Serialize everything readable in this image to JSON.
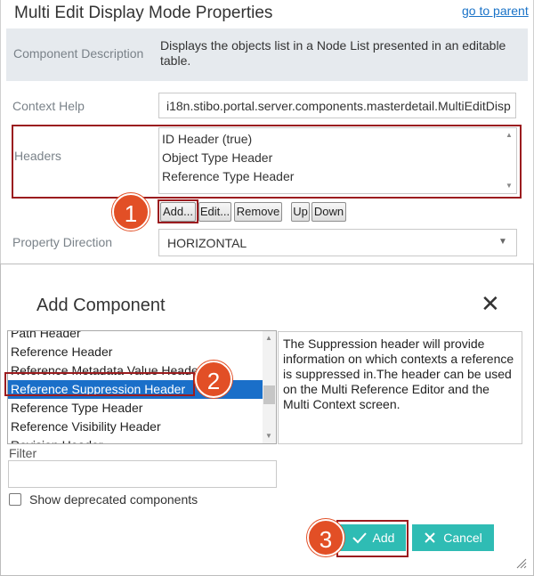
{
  "properties": {
    "title": "Multi Edit Display Mode Properties",
    "parent_link": "go to parent",
    "component_description": {
      "label": "Component Description",
      "text": "Displays the objects list in a Node List presented in an editable table."
    },
    "context_help": {
      "label": "Context Help",
      "value": "i18n.stibo.portal.server.components.masterdetail.MultiEditDisp"
    },
    "headers": {
      "label": "Headers",
      "items": [
        "ID Header (true)",
        "Object Type Header",
        "Reference Type Header"
      ]
    },
    "buttons": {
      "add": "Add...",
      "edit": "Edit...",
      "remove": "Remove",
      "up": "Up",
      "down": "Down"
    },
    "property_direction": {
      "label": "Property Direction",
      "value": "HORIZONTAL"
    }
  },
  "dialog": {
    "title": "Add Component",
    "components": [
      "Path Header",
      "Reference Header",
      "Reference Metadata Value Header",
      "Reference Suppression Header",
      "Reference Type Header",
      "Reference Visibility Header",
      "Revision Header"
    ],
    "selected": "Reference Suppression Header",
    "description": "The Suppression header will provide information on which contexts a reference is suppressed in.The header can be used on the Multi Reference Editor and the Multi Context screen.",
    "filter_label": "Filter",
    "filter_value": "",
    "show_deprecated_label": "Show deprecated components",
    "show_deprecated_checked": false,
    "add_label": "Add",
    "cancel_label": "Cancel"
  },
  "callouts": [
    "1",
    "2",
    "3"
  ],
  "colors": {
    "accent_teal": "#2fbcb4",
    "callout_orange": "#e24f26",
    "highlight_red": "#9b1c1f",
    "selection_blue": "#1a6fc9",
    "description_bg": "#e6eaee",
    "link_blue": "#1a73c8"
  },
  "icons": {
    "close": "close-icon",
    "check": "check-icon",
    "cancel_x": "x-icon",
    "select_chevron": "chevron-down-icon",
    "resize": "resize-grip-icon"
  }
}
